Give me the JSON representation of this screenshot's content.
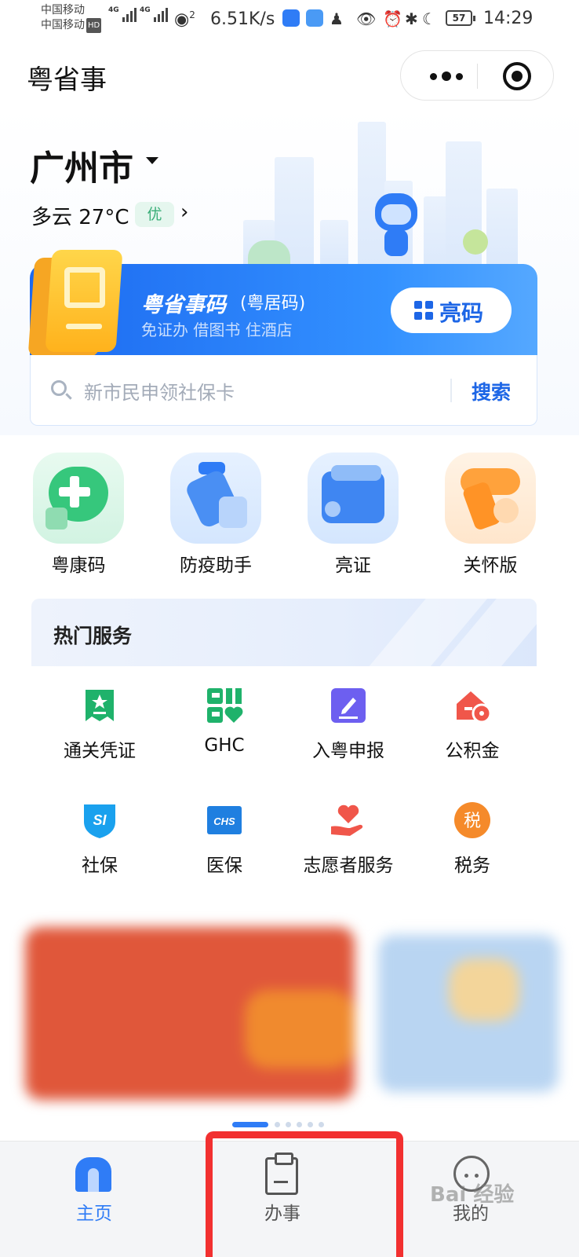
{
  "status_bar": {
    "carrier_1": "中国移动",
    "carrier_2": "中国移动",
    "hd": "HD",
    "net_type": "4G",
    "wifi_num": "2",
    "net_speed": "6.51K/s",
    "battery": "57",
    "time": "14:29"
  },
  "titlebar": {
    "app_title": "粤省事"
  },
  "location": {
    "city": "广州市",
    "weather": "多云 27°C",
    "aqi": "优"
  },
  "code_card": {
    "title": "粤省事码",
    "subtitle": "(粤居码)",
    "desc": "免证办 借图书 住酒店",
    "show_button": "亮码"
  },
  "search": {
    "placeholder": "新市民申领社保卡",
    "button": "搜索"
  },
  "shortcuts": [
    {
      "label": "粤康码",
      "color": "#4fd08a"
    },
    {
      "label": "防疫助手",
      "color": "#4a8ff3"
    },
    {
      "label": "亮证",
      "color": "#3f86f2"
    },
    {
      "label": "关怀版",
      "color": "#ffa23c"
    }
  ],
  "hot_services": {
    "title": "热门服务",
    "items": [
      {
        "label": "通关凭证",
        "icon": "voucher-icon",
        "color": "#1fb26b"
      },
      {
        "label": "GHC",
        "icon": "ghc-icon",
        "color": "#1fb26b"
      },
      {
        "label": "入粤申报",
        "icon": "declare-icon",
        "color": "#6d5ff0"
      },
      {
        "label": "公积金",
        "icon": "house-fund-icon",
        "color": "#f0564a"
      },
      {
        "label": "社保",
        "icon": "social-security-icon",
        "color": "#1aa1ee"
      },
      {
        "label": "医保",
        "icon": "medical-insurance-icon",
        "color": "#1f7fe0"
      },
      {
        "label": "志愿者服务",
        "icon": "volunteer-icon",
        "color": "#f0564a"
      },
      {
        "label": "税务",
        "icon": "tax-icon",
        "color": "#f58a2a"
      }
    ],
    "icon_text": {
      "social_security": "SI",
      "medical": "CHS",
      "tax": "税"
    }
  },
  "tabbar": {
    "home": "主页",
    "tasks": "办事",
    "me": "我的",
    "active_color": "#2f7cf6"
  },
  "watermark": "Bai 经验"
}
